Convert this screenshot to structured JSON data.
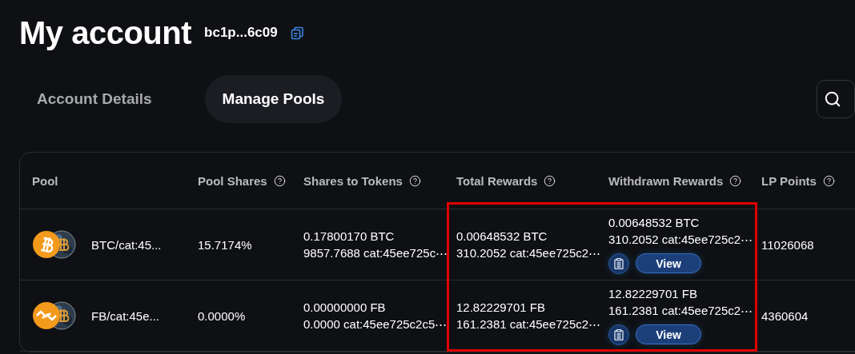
{
  "header": {
    "title": "My account",
    "address": "bc1p...6c09"
  },
  "tabs": [
    {
      "label": "Account Details",
      "selected": false
    },
    {
      "label": "Manage Pools",
      "selected": true
    }
  ],
  "table": {
    "columns": [
      "Pool",
      "Pool Shares",
      "Shares to Tokens",
      "Total Rewards",
      "Withdrawn Rewards",
      "LP Points"
    ],
    "rows": [
      {
        "kind": "bitcoin",
        "pool": "BTC/cat:45...",
        "pool_shares": "15.7174%",
        "shares_to_tokens": [
          "0.17800170 BTC",
          "9857.7688 cat:45ee725c⋯"
        ],
        "total_rewards": [
          "0.00648532 BTC",
          "310.2052 cat:45ee725c2⋯"
        ],
        "withdrawn_rewards": [
          "0.00648532 BTC",
          "310.2052 cat:45ee725c2⋯"
        ],
        "view_button": "View",
        "lp_points": "11026068"
      },
      {
        "kind": "chain",
        "pool": "FB/cat:45e...",
        "pool_shares": "0.0000%",
        "shares_to_tokens": [
          "0.00000000 FB",
          "0.0000 cat:45ee725c2c5⋯"
        ],
        "total_rewards": [
          "12.82229701 FB",
          "161.2381 cat:45ee725c2⋯"
        ],
        "withdrawn_rewards": [
          "12.82229701 FB",
          "161.2381 cat:45ee725c2⋯"
        ],
        "view_button": "View",
        "lp_points": "4360604"
      }
    ]
  }
}
